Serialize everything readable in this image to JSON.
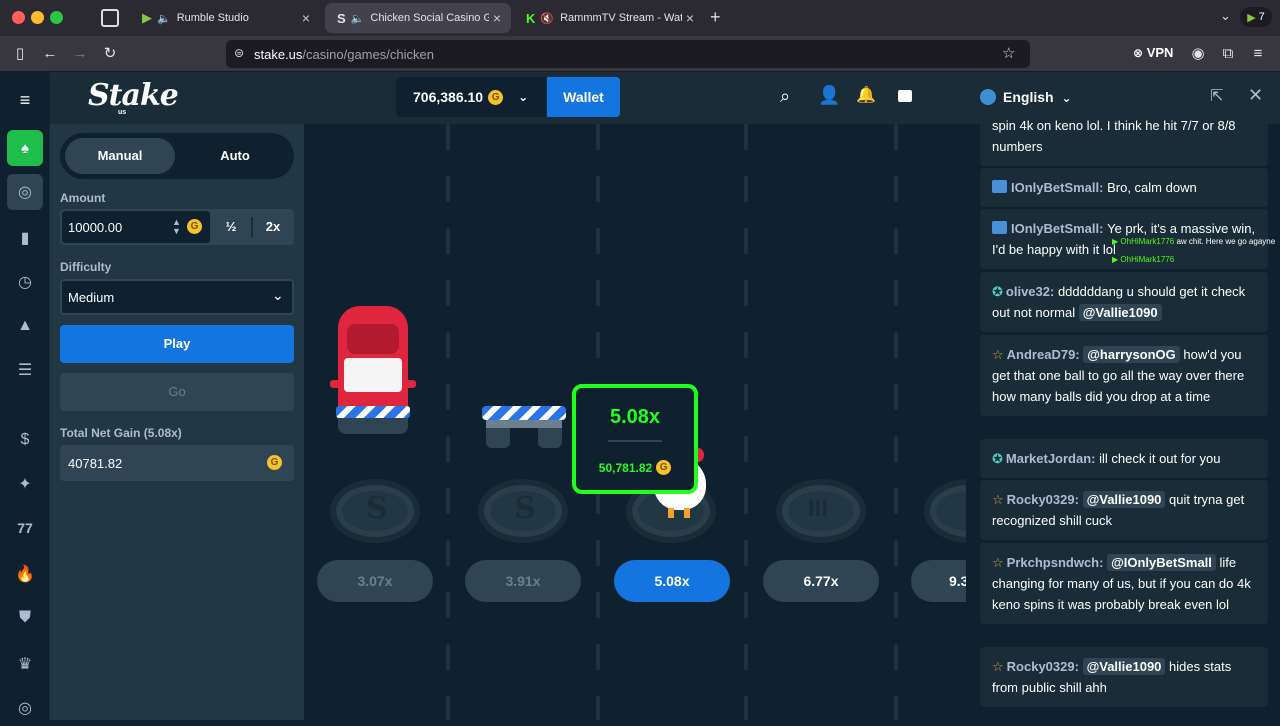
{
  "browser": {
    "tabs": [
      {
        "label": "Rumble Studio"
      },
      {
        "label": "Chicken Social Casino Gam"
      },
      {
        "label": "RammmTV Stream - Watch"
      }
    ],
    "url_host": "stake.us",
    "url_path": "/casino/games/chicken",
    "vpn_label": "VPN",
    "ext_badge": "7"
  },
  "header": {
    "logo": "Stake",
    "logo_sub": "us",
    "balance": "706,386.10",
    "wallet_label": "Wallet"
  },
  "panel": {
    "mode_tabs": [
      "Manual",
      "Auto"
    ],
    "amount_label": "Amount",
    "amount_value": "10000.00",
    "half_label": "½",
    "double_label": "2x",
    "difficulty_label": "Difficulty",
    "difficulty_value": "Medium",
    "play_label": "Play",
    "go_label": "Go",
    "net_gain_label": "Total Net Gain (5.08x)",
    "net_gain_value": "40781.82"
  },
  "game": {
    "popup_multiplier": "5.08x",
    "popup_amount": "50,781.82",
    "multipliers": [
      "3.07x",
      "3.91x",
      "5.08x",
      "6.77x",
      "9.3"
    ]
  },
  "chat": {
    "language": "English",
    "messages": [
      {
        "top_text": "spin 4k on keno lol. I think he hit 7/7 or 8/8 numbers"
      },
      {
        "user": "IOnlyBetSmall",
        "text": "Bro, calm down"
      },
      {
        "user": "IOnlyBetSmall",
        "text": "Ye prk, it's a massive win, I'd be happy with it lol"
      },
      {
        "user": "olive32",
        "text": "ddddddang u should get it check out not normal",
        "mention": "@Vallie1090"
      },
      {
        "user": "AndreaD79",
        "mention": "@harrysonOG",
        "text": "how'd you get that one ball to go all the way over there how many balls did you drop at a time"
      },
      {
        "user": "MarketJordan",
        "text": "ill check it out for you"
      },
      {
        "user": "Rocky0329",
        "mention": "@Vallie1090",
        "text": "quit tryna get recognized shill cuck"
      },
      {
        "user": "Prkchpsndwch",
        "mention": "@IOnlyBetSmall",
        "text": "life changing for many of us, but if you can do 4k keno spins it was probably break even lol"
      },
      {
        "user": "Rocky0329",
        "mention": "@Vallie1090",
        "text": "hides stats from public shill ahh"
      }
    ],
    "overlay": {
      "user1": "OhHiMark1776",
      "text1": "aw chit. Here we go agayne",
      "user2": "OhHiMark1776"
    }
  },
  "colors": {
    "accent_green": "#1fff20",
    "button_blue": "#1475e1",
    "panel": "#213743"
  }
}
